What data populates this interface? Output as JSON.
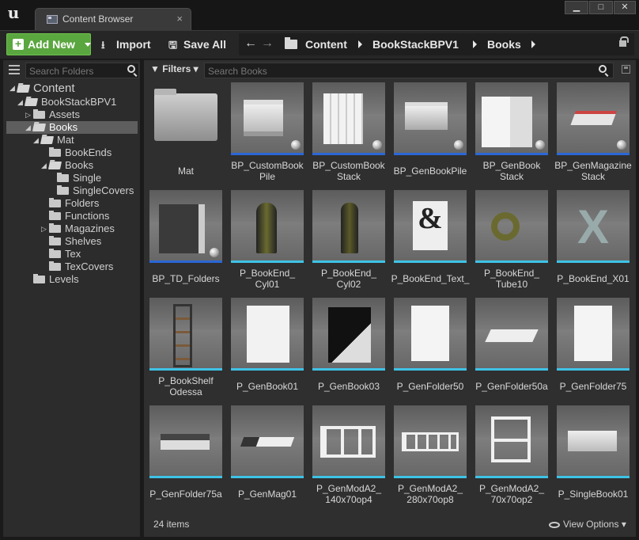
{
  "titlebar": {
    "tab_label": "Content Browser",
    "tab_close": "×",
    "minimize": "▁",
    "maximize": "□",
    "close": "✕"
  },
  "toolbar": {
    "add_new": "Add New",
    "import": "Import",
    "save_all": "Save All"
  },
  "nav": {
    "back": "←",
    "forward": "→",
    "breadcrumb": [
      "Content",
      "BookStackBPV1",
      "Books"
    ]
  },
  "sources": {
    "search_placeholder": "Search Folders",
    "tree": [
      {
        "label": "Content",
        "depth": 0,
        "expander": "open"
      },
      {
        "label": "BookStackBPV1",
        "depth": 1,
        "expander": "open"
      },
      {
        "label": "Assets",
        "depth": 2,
        "expander": "closed"
      },
      {
        "label": "Books",
        "depth": 2,
        "expander": "open",
        "selected": true
      },
      {
        "label": "Mat",
        "depth": 3,
        "expander": "open"
      },
      {
        "label": "BookEnds",
        "depth": 4,
        "expander": "none"
      },
      {
        "label": "Books",
        "depth": 4,
        "expander": "open"
      },
      {
        "label": "Single",
        "depth": 5,
        "expander": "none"
      },
      {
        "label": "SingleCovers",
        "depth": 5,
        "expander": "none"
      },
      {
        "label": "Folders",
        "depth": 4,
        "expander": "none"
      },
      {
        "label": "Functions",
        "depth": 4,
        "expander": "none"
      },
      {
        "label": "Magazines",
        "depth": 4,
        "expander": "closed"
      },
      {
        "label": "Shelves",
        "depth": 4,
        "expander": "none"
      },
      {
        "label": "Tex",
        "depth": 4,
        "expander": "none"
      },
      {
        "label": "TexCovers",
        "depth": 4,
        "expander": "none"
      },
      {
        "label": "Levels",
        "depth": 2,
        "expander": "none"
      }
    ]
  },
  "assets": {
    "filters_label": "Filters",
    "search_placeholder": "Search Books",
    "items": [
      {
        "name": "Mat",
        "kind": "folder",
        "underline": "none"
      },
      {
        "name": "BP_CustomBook Pile",
        "kind": "blueprint",
        "underline": "#2b67d6"
      },
      {
        "name": "BP_CustomBook Stack",
        "kind": "blueprint",
        "underline": "#2b67d6"
      },
      {
        "name": "BP_GenBookPile",
        "kind": "blueprint",
        "underline": "#2b67d6"
      },
      {
        "name": "BP_GenBook Stack",
        "kind": "blueprint",
        "underline": "#2b67d6"
      },
      {
        "name": "BP_GenMagazine Stack",
        "kind": "blueprint",
        "underline": "#2b67d6"
      },
      {
        "name": "BP_TD_Folders",
        "kind": "blueprint",
        "underline": "#2b67d6"
      },
      {
        "name": "P_BookEnd_ Cyl01",
        "kind": "mesh",
        "underline": "#3ec2e6"
      },
      {
        "name": "P_BookEnd_ Cyl02",
        "kind": "mesh",
        "underline": "#3ec2e6"
      },
      {
        "name": "P_BookEnd_Text_",
        "kind": "mesh",
        "underline": "#3ec2e6"
      },
      {
        "name": "P_BookEnd_ Tube10",
        "kind": "mesh",
        "underline": "#3ec2e6"
      },
      {
        "name": "P_BookEnd_X01",
        "kind": "mesh",
        "underline": "#3ec2e6"
      },
      {
        "name": "P_BookShelf Odessa",
        "kind": "mesh",
        "underline": "#3ec2e6"
      },
      {
        "name": "P_GenBook01",
        "kind": "mesh",
        "underline": "#3ec2e6"
      },
      {
        "name": "P_GenBook03",
        "kind": "mesh",
        "underline": "#3ec2e6"
      },
      {
        "name": "P_GenFolder50",
        "kind": "mesh",
        "underline": "#3ec2e6"
      },
      {
        "name": "P_GenFolder50a",
        "kind": "mesh",
        "underline": "#3ec2e6"
      },
      {
        "name": "P_GenFolder75",
        "kind": "mesh",
        "underline": "#3ec2e6"
      },
      {
        "name": "P_GenFolder75a",
        "kind": "mesh",
        "underline": "#3ec2e6"
      },
      {
        "name": "P_GenMag01",
        "kind": "mesh",
        "underline": "#3ec2e6"
      },
      {
        "name": "P_GenModA2_ 140x70op4",
        "kind": "mesh",
        "underline": "#3ec2e6"
      },
      {
        "name": "P_GenModA2_ 280x70op8",
        "kind": "mesh",
        "underline": "#3ec2e6"
      },
      {
        "name": "P_GenModA2_ 70x70op2",
        "kind": "mesh",
        "underline": "#3ec2e6"
      },
      {
        "name": "P_SingleBook01",
        "kind": "mesh",
        "underline": "#3ec2e6"
      }
    ],
    "item_count": "24 items",
    "view_options": "View Options"
  },
  "colors": {
    "add_new_green": "#5aa63f",
    "blueprint_underline": "#2b67d6",
    "mesh_underline": "#3ec2e6"
  }
}
